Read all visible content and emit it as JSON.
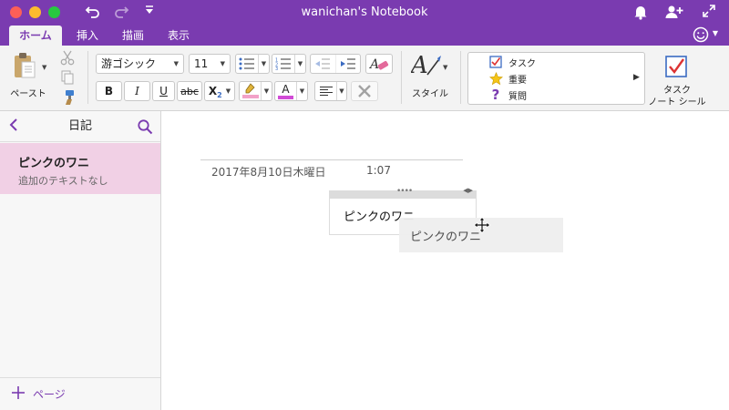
{
  "window": {
    "title": "wanichan's Notebook"
  },
  "tabs": [
    {
      "label": "ホーム",
      "active": true
    },
    {
      "label": "挿入",
      "active": false
    },
    {
      "label": "描画",
      "active": false
    },
    {
      "label": "表示",
      "active": false
    }
  ],
  "ribbon": {
    "paste_label": "ペースト",
    "font_name": "游ゴシック",
    "font_size": "11",
    "style_label": "スタイル",
    "bold": "B",
    "italic": "I",
    "underline": "U",
    "strike": "abc",
    "subscript": "X",
    "subscript_suffix": "2",
    "font_color_letter": "A",
    "highlight_color": "#f2a1c8",
    "font_color": "#d14bd6",
    "tags": [
      {
        "label": "タスク",
        "icon": "checkbox-icon"
      },
      {
        "label": "重要",
        "icon": "star-icon"
      },
      {
        "label": "質問",
        "icon": "question-icon"
      }
    ],
    "tag_task_label_line1": "タスク",
    "tag_task_label_line2": "ノート シール"
  },
  "sidebar": {
    "back_icon": "chevron-left-icon",
    "title": "日記",
    "pages": [
      {
        "title": "ピンクのワニ",
        "subtitle": "追加のテキストなし",
        "selected": true
      }
    ],
    "add_page_label": "ページ"
  },
  "canvas": {
    "date": "2017年8月10日木曜日",
    "time": "1:07",
    "note_text": "ピンクのワニ",
    "drag_text": "ピンクのワニ"
  },
  "colors": {
    "accent": "#7a3bb0",
    "selected_page": "#f1d0e5"
  }
}
